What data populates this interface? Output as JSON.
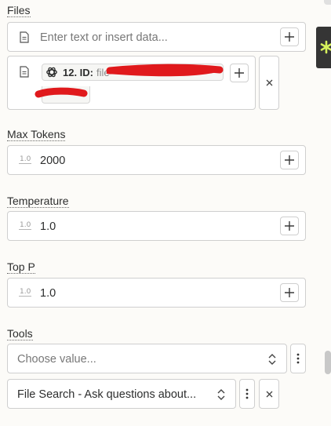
{
  "files": {
    "label": "Files",
    "placeholder": "Enter text or insert data...",
    "tag": {
      "label": "12. ID:",
      "value": "file-"
    }
  },
  "max_tokens": {
    "label": "Max Tokens",
    "value": "2000",
    "icon_text": "1.0"
  },
  "temperature": {
    "label": "Temperature",
    "value": "1.0",
    "icon_text": "1.0"
  },
  "top_p": {
    "label": "Top P",
    "value": "1.0",
    "icon_text": "1.0"
  },
  "tools": {
    "label": "Tools",
    "placeholder": "Choose value...",
    "selected_item": "File Search - Ask questions about..."
  },
  "colors": {
    "background": "#fcfbf8",
    "border": "#cfcfcf",
    "redaction": "#e0191c",
    "side_panel": "#353535",
    "asterisk": "#d7f25c"
  },
  "icons": {
    "plus": "plus-icon",
    "document": "document-icon",
    "number": "number-icon",
    "openai": "openai-icon",
    "close": "close-icon",
    "chevron": "chevron-updown-icon",
    "kebab": "kebab-icon",
    "asterisk": "asterisk-icon"
  }
}
